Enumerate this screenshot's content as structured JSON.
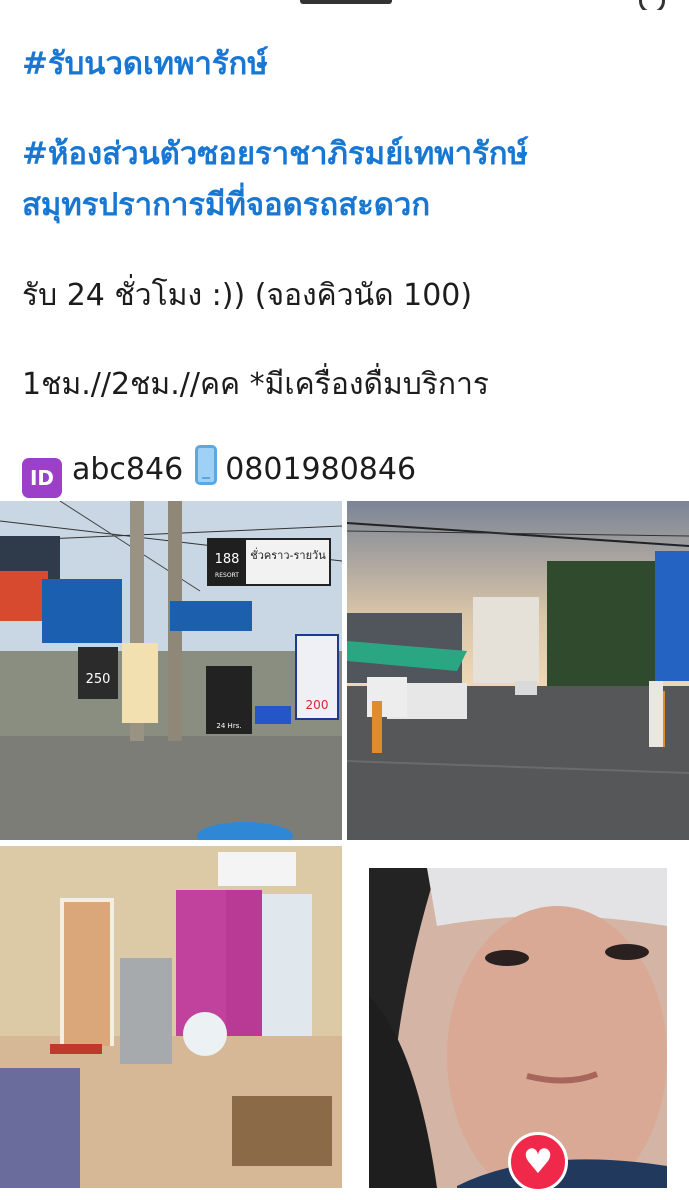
{
  "post": {
    "hashtag_1": "#รับนวดเทพารักษ์",
    "hashtag_2_line1": "#ห้องส่วนตัวซอยราชาภิรมย์เทพารักษ์",
    "hashtag_2_line2": "สมุทรปราการมีที่จอดรถสะดวก",
    "line_hours": "รับ 24 ชั่วโมง :)) (จองคิวนัด 100)",
    "line_pricing": "1ชม.//2ชม.//คค *มีเครื่องดื่มบริการ",
    "id_badge": "ID",
    "line_id": "abc846",
    "phone_number": "0801980846"
  },
  "photos": {
    "street_sign_brand": "188",
    "street_sign_sub": "RESORT",
    "street_sign_text": "ชั่วคราว-รายวัน",
    "street_price": "250",
    "street_price_2": "200",
    "hours_sign": "24 Hrs."
  },
  "reaction": {
    "icon": "heart-icon"
  },
  "colors": {
    "hashtag": "#1877d2",
    "heart": "#f0284a",
    "id_badge": "#9c3fc9"
  }
}
